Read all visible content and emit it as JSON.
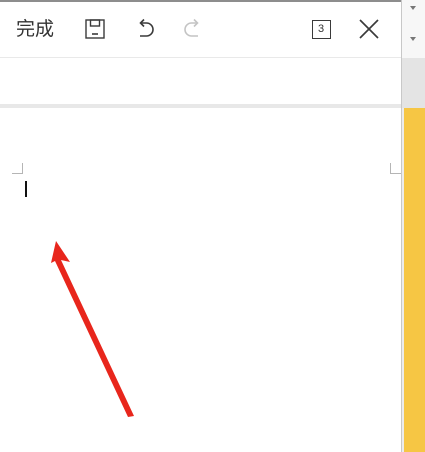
{
  "toolbar": {
    "done_label": "完成",
    "save_icon": "save-icon",
    "undo_icon": "undo-icon",
    "redo_icon": "redo-icon",
    "count_value": "3",
    "close_icon": "close-icon"
  },
  "editor": {
    "content": ""
  },
  "colors": {
    "annotation_arrow": "#e8261c",
    "background_accent": "#f6c644",
    "icon": "#3a3a3a",
    "icon_disabled": "#c4c4c4"
  }
}
